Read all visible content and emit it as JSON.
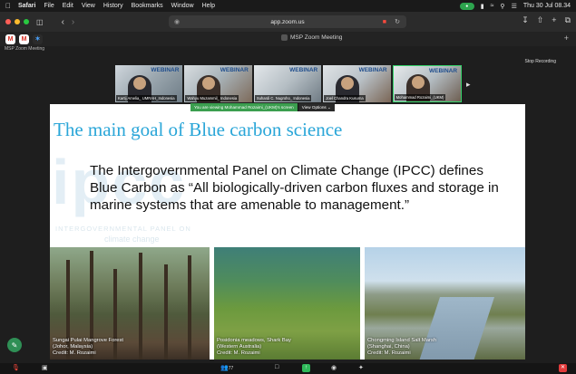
{
  "menubar": {
    "app_name": "Safari",
    "items": [
      "File",
      "Edit",
      "View",
      "History",
      "Bookmarks",
      "Window",
      "Help"
    ],
    "clock": "Thu 30 Jul  08.34"
  },
  "toolbar": {
    "url": "app.zoom.us"
  },
  "tabbar": {
    "active_tab_title": "MSP Zoom Meeting"
  },
  "zoom": {
    "meeting_label": "MSP Zoom Meeting",
    "stop_recording_label": "Stop Recording",
    "participants_count": "77",
    "gallery": [
      {
        "name": "Kartij Amelia_ UMRAH_Indonesia",
        "webinar": "WEBINAR"
      },
      {
        "name": "Wahyu Muzammil_ Indonesia",
        "webinar": "WEBINAR"
      },
      {
        "name": "Suhardi C. Nugroho_ Indonesia",
        "webinar": "WEBINAR"
      },
      {
        "name": "Joel Chandra Kusuma",
        "webinar": "WEBINAR"
      },
      {
        "name": "Mohammad Rozaimi_(UKM)",
        "webinar": "WEBINAR"
      }
    ],
    "viewing_text": "You are viewing  Mohammad Rozaimi_(UKM)'s screen",
    "view_options_label": "View Options ⌄"
  },
  "slide": {
    "title": "The main goal of Blue carbon science",
    "watermark": "ipcc",
    "watermark_sub1": "INTERGOVERNMENTAL PANEL ON",
    "watermark_sub2": "climate change",
    "body": "The Intergovernmental Panel on Climate Change (IPCC) defines Blue Carbon as “All biologically-driven carbon fluxes and storage in marine systems that are amenable to management.”",
    "photos": [
      {
        "caption1": "Sungai Pulai Mangrove Forest",
        "caption2": "(Johor, Malaysia)",
        "caption3": "Credit: M. Rozaimi"
      },
      {
        "caption1": "Posidonia meadows, Shark Bay",
        "caption2": "(Western Australia)",
        "caption3": "Credit: M. Rozaimi"
      },
      {
        "caption1": "Chongming Island Salt Marsh",
        "caption2": "(Shanghai, China)",
        "caption3": "Credit: M. Rozaimi"
      }
    ]
  }
}
